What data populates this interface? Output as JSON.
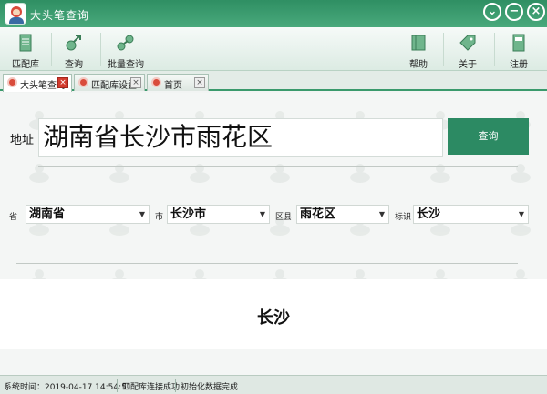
{
  "window": {
    "title": "大头笔查询"
  },
  "toolbar": {
    "items": [
      {
        "label": "匹配库",
        "icon": "document-icon"
      },
      {
        "label": "查询",
        "icon": "search-arrow-icon"
      },
      {
        "label": "批量查询",
        "icon": "batch-query-icon"
      },
      {
        "label": "帮助",
        "icon": "help-book-icon"
      },
      {
        "label": "关于",
        "icon": "tag-icon"
      },
      {
        "label": "注册",
        "icon": "register-doc-icon"
      }
    ]
  },
  "tabs": [
    {
      "label": "大头笔查询",
      "active": true
    },
    {
      "label": "匹配库设置",
      "active": false
    },
    {
      "label": "首页",
      "active": false
    }
  ],
  "form": {
    "address_label": "地址",
    "address_value": "湖南省长沙市雨花区",
    "query_button": "查询",
    "province_label": "省",
    "province_value": "湖南省",
    "city_label": "市",
    "city_value": "长沙市",
    "district_label": "区县",
    "district_value": "雨花区",
    "tag_label": "标识",
    "tag_value": "长沙"
  },
  "result": {
    "text": "长沙"
  },
  "status": {
    "system_time": "系统时间：2019-04-17 14:54:51",
    "db_status": "匹配库连接成功",
    "init_status": "初始化数据完成"
  },
  "colors": {
    "accent": "#2c8a63",
    "title_bar": "#3a9a6c",
    "close_tab": "#d23b2e"
  }
}
